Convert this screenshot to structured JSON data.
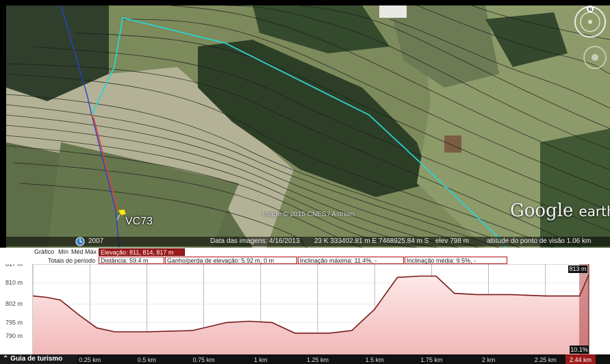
{
  "map": {
    "copyright": "Image © 2015 CNES / Astrium",
    "logo_main": "Google",
    "logo_sub": "earth",
    "marker_label": "VC73",
    "history_year": "2007",
    "status": {
      "imagery_date": "Data das imagens: 4/16/2013",
      "coords": "23 K 333402.81 m E 7468925.84 m S",
      "elev": "elev   798 m",
      "eye_alt": "altitude do ponto de visão   1.06 km"
    },
    "compass_letter": "N",
    "colors": {
      "track_cyan": "#2ad4d4",
      "track_red": "#e0402c",
      "track_blue": "#2a3fd0"
    }
  },
  "info_bar": {
    "graph_label": "Gráfico",
    "min": "Mín",
    "avg": "Méd",
    "max": "Máx",
    "elevation": "Elevação: 811, 814, 817 m",
    "totals_label": "Totais do período",
    "distance": "Distância: 59.4 m",
    "gain_loss": "Ganho/perda de elevação: 5.92 m, 0 m",
    "max_slope": "Inclinação máxima: 11.4%, -",
    "avg_slope": "Inclinação média: 9.5%, -"
  },
  "chart_data": {
    "type": "area",
    "y_tick_labels": [
      "817 m",
      "810 m",
      "802 m",
      "795 m",
      "790 m"
    ],
    "y_ticks": [
      817,
      810,
      802,
      795,
      790
    ],
    "ylim": [
      783,
      817
    ],
    "x_tick_labels": [
      "0.25 km",
      "0.5 km",
      "0.75 km",
      "1 km",
      "1.25 km",
      "1.5 km",
      "1.75 km",
      "2 km",
      "2.25 km"
    ],
    "x_ticks": [
      0.25,
      0.5,
      0.75,
      1.0,
      1.25,
      1.5,
      1.75,
      2.0,
      2.25
    ],
    "xlim": [
      0,
      2.44
    ],
    "x_end_label": "2.44 km",
    "cursor_elevation_label": "813 m",
    "cursor_slope_label": "10.1%",
    "x": [
      0,
      0.06,
      0.12,
      0.2,
      0.28,
      0.36,
      0.5,
      0.7,
      0.85,
      0.95,
      1.05,
      1.15,
      1.3,
      1.4,
      1.5,
      1.6,
      1.7,
      1.77,
      1.85,
      1.95,
      2.1,
      2.25,
      2.34,
      2.4,
      2.44
    ],
    "y": [
      805,
      804.5,
      803.5,
      798,
      793,
      791.5,
      791.5,
      792,
      795,
      795.5,
      795,
      791,
      791,
      792,
      800,
      812,
      812.5,
      812.5,
      806,
      805.5,
      805.5,
      805,
      805,
      805,
      813
    ],
    "colors": {
      "line": "#7a1818",
      "fill": "#f6c9c9",
      "fill_top": "#fde9e9",
      "grid": "#8a8a8a"
    }
  },
  "guide": {
    "label": "Guia de turismo"
  }
}
